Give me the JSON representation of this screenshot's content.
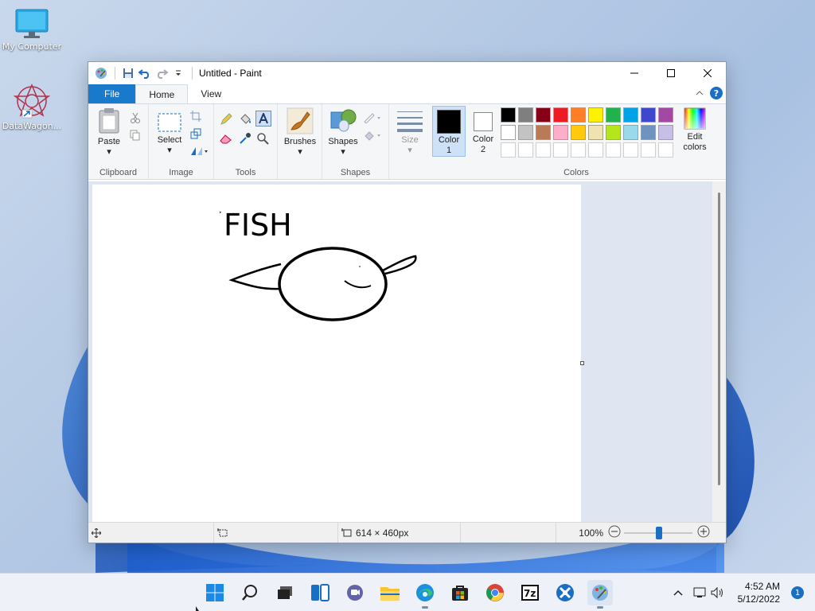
{
  "desktop": {
    "icons": [
      {
        "label": "My Computer"
      },
      {
        "label": "DataWagon..."
      }
    ]
  },
  "window": {
    "title": "Untitled - Paint"
  },
  "tabs": [
    {
      "label": "File"
    },
    {
      "label": "Home"
    },
    {
      "label": "View"
    }
  ],
  "ribbon": {
    "clipboard": {
      "paste": "Paste",
      "group": "Clipboard"
    },
    "image": {
      "select": "Select",
      "group": "Image"
    },
    "tools": {
      "group": "Tools"
    },
    "brushes": {
      "label": "Brushes"
    },
    "shapes": {
      "label": "Shapes",
      "group": "Shapes"
    },
    "size": {
      "label": "Size"
    },
    "color1": {
      "line1": "Color",
      "line2": "1"
    },
    "color2": {
      "line1": "Color",
      "line2": "2"
    },
    "edit_colors": {
      "line1": "Edit",
      "line2": "colors"
    },
    "colors_group": "Colors",
    "palette_row1": [
      "#000000",
      "#7f7f7f",
      "#880015",
      "#ed1c24",
      "#ff7f27",
      "#fff200",
      "#22b14c",
      "#00a2e8",
      "#3f48cc",
      "#a349a4"
    ],
    "palette_row2": [
      "#ffffff",
      "#c3c3c3",
      "#b97a57",
      "#ffaec9",
      "#ffc90e",
      "#efe4b0",
      "#b5e61d",
      "#99d9ea",
      "#7092be",
      "#c8bfe7"
    ],
    "palette_row3": [
      "#ffffff",
      "#ffffff",
      "#ffffff",
      "#ffffff",
      "#ffffff",
      "#ffffff",
      "#ffffff",
      "#ffffff",
      "#ffffff",
      "#ffffff"
    ],
    "color1_value": "#000000",
    "color2_value": "#ffffff"
  },
  "canvas": {
    "text": "FISH"
  },
  "status": {
    "dimensions": "614 × 460px",
    "zoom": "100%"
  },
  "taskbar": {
    "time": "4:52 AM",
    "date": "5/12/2022",
    "notifications": "1"
  }
}
